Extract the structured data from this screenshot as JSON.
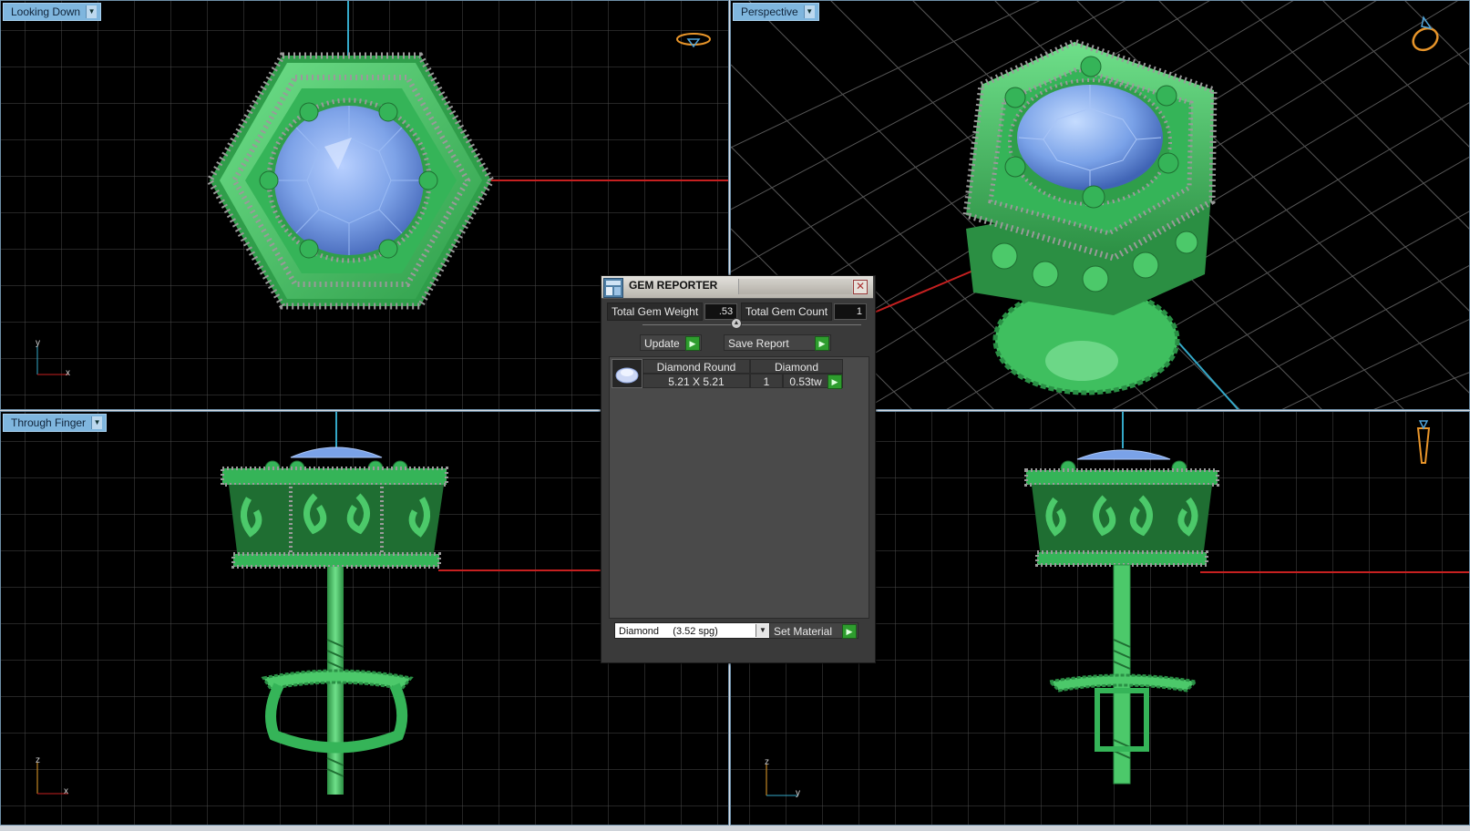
{
  "viewports": {
    "top_left": {
      "label": "Looking Down",
      "axis_a": "y",
      "axis_b": "x"
    },
    "top_right": {
      "label": "Perspective"
    },
    "bottom_left": {
      "label": "Through Finger",
      "axis_a": "z",
      "axis_b": "x"
    },
    "bottom_right": {
      "axis_a": "z",
      "axis_b": "y"
    }
  },
  "gem_reporter": {
    "title": "GEM REPORTER",
    "total_gem_weight_label": "Total Gem Weight",
    "total_gem_weight_value": ".53",
    "total_gem_count_label": "Total Gem Count",
    "total_gem_count_value": "1",
    "update_label": "Update",
    "save_report_label": "Save Report",
    "gem_rows": [
      {
        "shape": "Diamond Round",
        "size": "5.21 X 5.21",
        "material": "Diamond",
        "count": "1",
        "weight": "0.53tw"
      }
    ],
    "material_select_value": "Diamond     (3.52 spg)",
    "set_material_label": "Set Material"
  },
  "colors": {
    "metal": "#4cc96a",
    "gem": "#7aa2e8",
    "bead": "#9a9a9a",
    "grid": "#3c3c3c",
    "x_axis": "#c62020",
    "z_axis": "#34a8c8",
    "label_bg": "#7fb6de"
  }
}
